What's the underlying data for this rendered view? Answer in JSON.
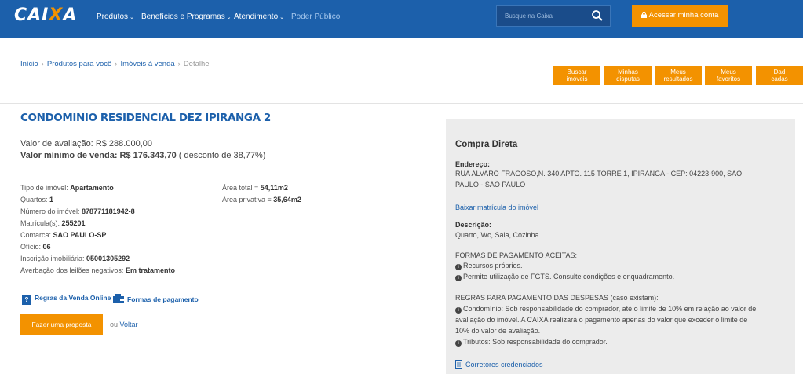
{
  "header": {
    "logo_main": "CAI",
    "logo_x": "X",
    "logo_end": "A",
    "nav": [
      {
        "label": "Produtos",
        "chevron": true
      },
      {
        "label": "Benefícios e Programas",
        "chevron": true
      },
      {
        "label": "Atendimento",
        "chevron": true
      },
      {
        "label": "Poder Público",
        "chevron": false
      }
    ],
    "search_placeholder": "Busque na Caixa",
    "account_button": "Acessar minha conta",
    "accent_color": "#f39200",
    "brand_color": "#1c60ab"
  },
  "breadcrumb": {
    "items": [
      "Início",
      "Produtos para você",
      "Imóveis à venda"
    ],
    "current": "Detalhe"
  },
  "tabs": [
    {
      "line1": "Buscar",
      "line2": "imóveis"
    },
    {
      "line1": "Minhas",
      "line2": "disputas"
    },
    {
      "line1": "Meus",
      "line2": "resultados"
    },
    {
      "line1": "Meus",
      "line2": "favoritos"
    },
    {
      "line1": "Dad",
      "line2": "cadas"
    }
  ],
  "property": {
    "title": "CONDOMINIO RESIDENCIAL DEZ IPIRANGA 2",
    "valuation_label": "Valor de avaliação:",
    "valuation_value": "R$ 288.000,00",
    "min_sale_label": "Valor mínimo de venda:",
    "min_sale_value": "R$ 176.343,70",
    "discount": "( desconto de 38,77%)",
    "details_left": [
      {
        "label": "Tipo de imóvel:",
        "value": "Apartamento"
      },
      {
        "label": "Quartos:",
        "value": "1"
      },
      {
        "label": "Número do imóvel:",
        "value": "878771181942-8"
      },
      {
        "label": "Matrícula(s):",
        "value": "255201"
      },
      {
        "label": "Comarca:",
        "value": "SAO PAULO-SP"
      },
      {
        "label": "Ofício:",
        "value": "06"
      },
      {
        "label": "Inscrição imobiliária:",
        "value": "05001305292"
      },
      {
        "label": "Averbação dos leilões negativos:",
        "value": "Em tratamento"
      }
    ],
    "details_right": [
      {
        "label": "Área total =",
        "value": "54,11m2"
      },
      {
        "label": "Área privativa =",
        "value": "35,64m2"
      }
    ],
    "link_rules": "Regras da Venda Online",
    "link_payment": "Formas de pagamento",
    "proposal_button": "Fazer uma proposta",
    "or_text": "ou",
    "back_link": "Voltar"
  },
  "panel": {
    "heading": "Compra Direta",
    "address_label": "Endereço:",
    "address_line1": "RUA ALVARO FRAGOSO,N. 340 APTO. 115 TORRE 1, IPIRANGA - CEP: 04223-900, SAO",
    "address_line2": "PAULO - SAO PAULO",
    "download_link": "Baixar matrícula do imóvel",
    "description_label": "Descrição:",
    "description": "Quarto, Wc, Sala, Cozinha. .",
    "payment_heading": "FORMAS DE PAGAMENTO ACEITAS:",
    "payment_items": [
      "Recursos próprios.",
      "Permite utilização de FGTS. Consulte condições e enquadramento."
    ],
    "expenses_heading": "REGRAS PARA PAGAMENTO DAS DESPESAS (caso existam):",
    "expenses_lines": [
      "Condomínio: Sob responsabilidade do comprador, até o limite de 10% em relação ao valor de",
      "avaliação do imóvel. A CAIXA realizará o pagamento apenas do valor que exceder o limite de",
      "10% do valor de avaliação.",
      "Tributos: Sob responsabilidade do comprador."
    ],
    "brokers_link": "Corretores credenciados"
  }
}
